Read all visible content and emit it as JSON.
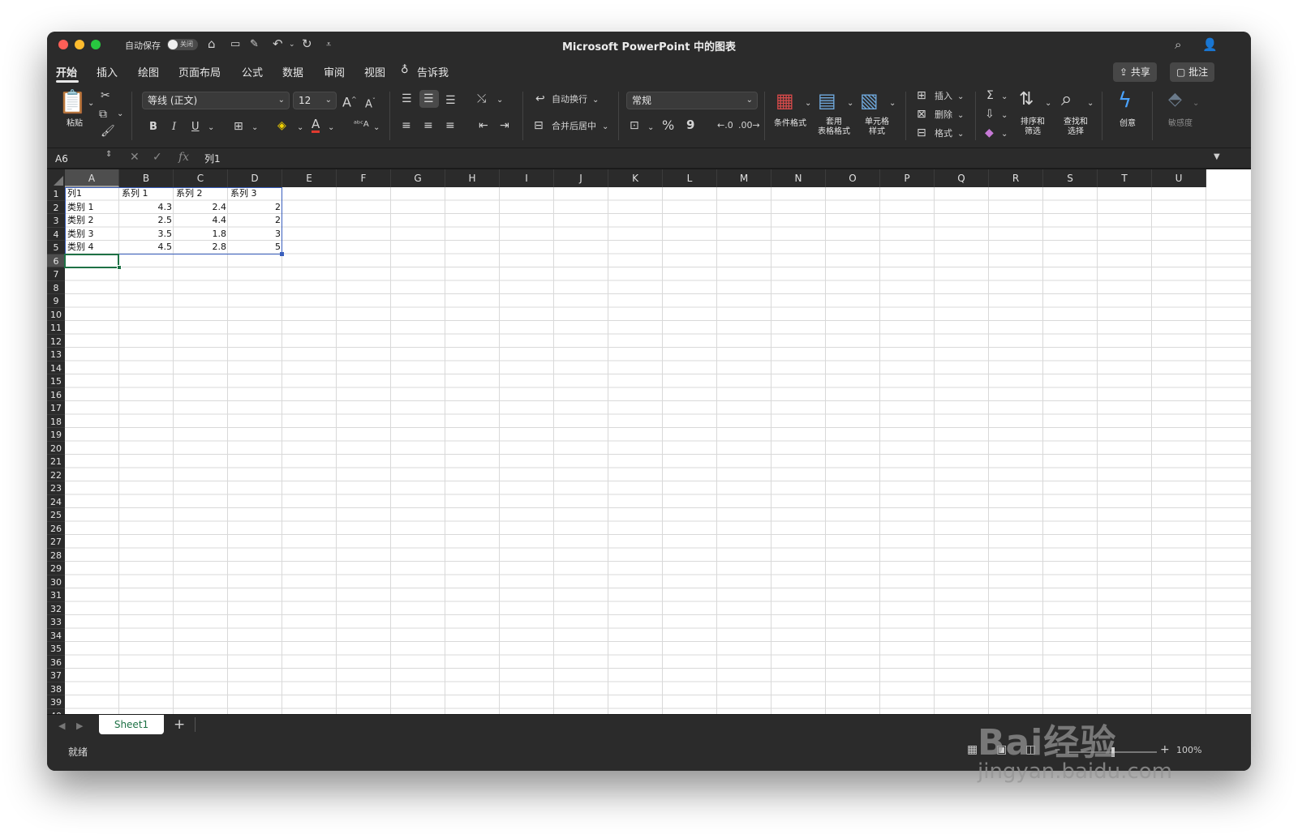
{
  "titlebar": {
    "autosave_label": "自动保存",
    "autosave_state": "关闭",
    "title": "Microsoft PowerPoint 中的图表"
  },
  "tabs": [
    {
      "label": "开始",
      "active": true
    },
    {
      "label": "插入"
    },
    {
      "label": "绘图"
    },
    {
      "label": "页面布局"
    },
    {
      "label": "公式"
    },
    {
      "label": "数据"
    },
    {
      "label": "审阅"
    },
    {
      "label": "视图"
    },
    {
      "label": "告诉我"
    }
  ],
  "tab_buttons": {
    "share": "共享",
    "comments": "批注"
  },
  "ribbon": {
    "paste": "粘贴",
    "font_name": "等线 (正文)",
    "font_size": "12",
    "bold": "B",
    "italic": "I",
    "underline": "U",
    "wrap_text": "自动换行",
    "merge_center": "合并后居中",
    "number_format": "常规",
    "percent": "%",
    "comma": "9",
    "conditional_format": "条件格式",
    "table_format": "套用\n表格格式",
    "cell_style": "单元格\n样式",
    "insert": "插入",
    "delete": "删除",
    "format": "格式",
    "sort_filter": "排序和\n筛选",
    "find_select": "查找和\n选择",
    "ideas": "创意",
    "sensitivity": "敏感度"
  },
  "formula_bar": {
    "name_box": "A6",
    "formula": "列1",
    "fx": "fx"
  },
  "columns": [
    "A",
    "B",
    "C",
    "D",
    "E",
    "F",
    "G",
    "H",
    "I",
    "J",
    "K",
    "L",
    "M",
    "N",
    "O",
    "P",
    "Q",
    "R",
    "S",
    "T",
    "U"
  ],
  "selected_column": "A",
  "row_count_visible": 40,
  "selected_row": 6,
  "sheet": {
    "header": [
      "列1",
      "系列 1",
      "系列 2",
      "系列 3"
    ],
    "rows": [
      [
        "类别 1",
        "4.3",
        "2.4",
        "2"
      ],
      [
        "类别 2",
        "2.5",
        "4.4",
        "2"
      ],
      [
        "类别 3",
        "3.5",
        "1.8",
        "3"
      ],
      [
        "类别 4",
        "4.5",
        "2.8",
        "5"
      ]
    ]
  },
  "sheet_tabs": {
    "active": "Sheet1",
    "add": "+"
  },
  "status": {
    "text": "就绪",
    "zoom": "100%"
  },
  "watermark": {
    "brand": "Bai经验",
    "url": "jingyan.baidu.com"
  }
}
